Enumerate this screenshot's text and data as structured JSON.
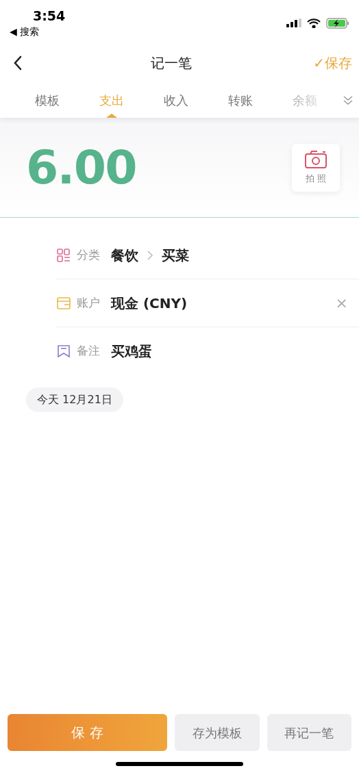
{
  "status_bar": {
    "time": "3:54",
    "back_label": "◀ 搜索"
  },
  "nav": {
    "title": "记一笔",
    "save": "✓保存"
  },
  "tabs": [
    {
      "label": "模板",
      "selected": false
    },
    {
      "label": "支出",
      "selected": true
    },
    {
      "label": "收入",
      "selected": false
    },
    {
      "label": "转账",
      "selected": false
    },
    {
      "label": "余额",
      "selected": false
    }
  ],
  "amount": "6.00",
  "photo_button": "拍 照",
  "fields": [
    {
      "kind": "category",
      "label": "分类",
      "value": "餐饮",
      "sub_value": "买菜"
    },
    {
      "kind": "account",
      "label": "账户",
      "value": "现金 (CNY)",
      "clear": "×"
    },
    {
      "kind": "note",
      "label": "备注",
      "value": "买鸡蛋"
    }
  ],
  "date_chip": "今天 12月21日",
  "buttons": [
    {
      "kind": "primary",
      "label": "保 存"
    },
    {
      "kind": "secondary",
      "label": "存为模板"
    },
    {
      "kind": "secondary",
      "label": "再记一笔"
    }
  ]
}
